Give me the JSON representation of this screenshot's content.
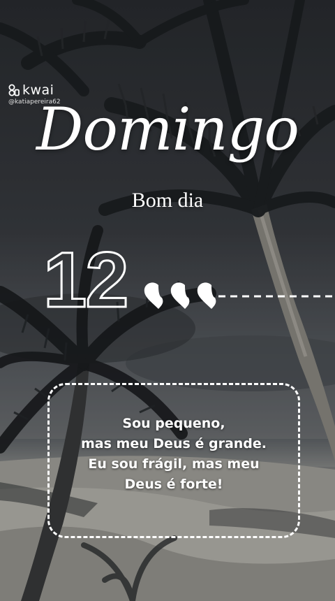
{
  "watermark": {
    "brand": "kwai",
    "handle": "@katiapereira62",
    "icon": "kwai-logo-icon"
  },
  "title": "Domingo",
  "subtitle": "Bom dia",
  "day": "12",
  "hearts": {
    "count": 3,
    "icon": "heart-icon",
    "color": "#ffffff"
  },
  "quote": {
    "lines": [
      "Sou pequeno,",
      "mas meu Deus é grande.",
      "Eu sou frágil, mas meu",
      "Deus é forte!"
    ]
  },
  "colors": {
    "text": "#ffffff",
    "sky": "#2a2d31",
    "sand": "#bdbbb4"
  }
}
